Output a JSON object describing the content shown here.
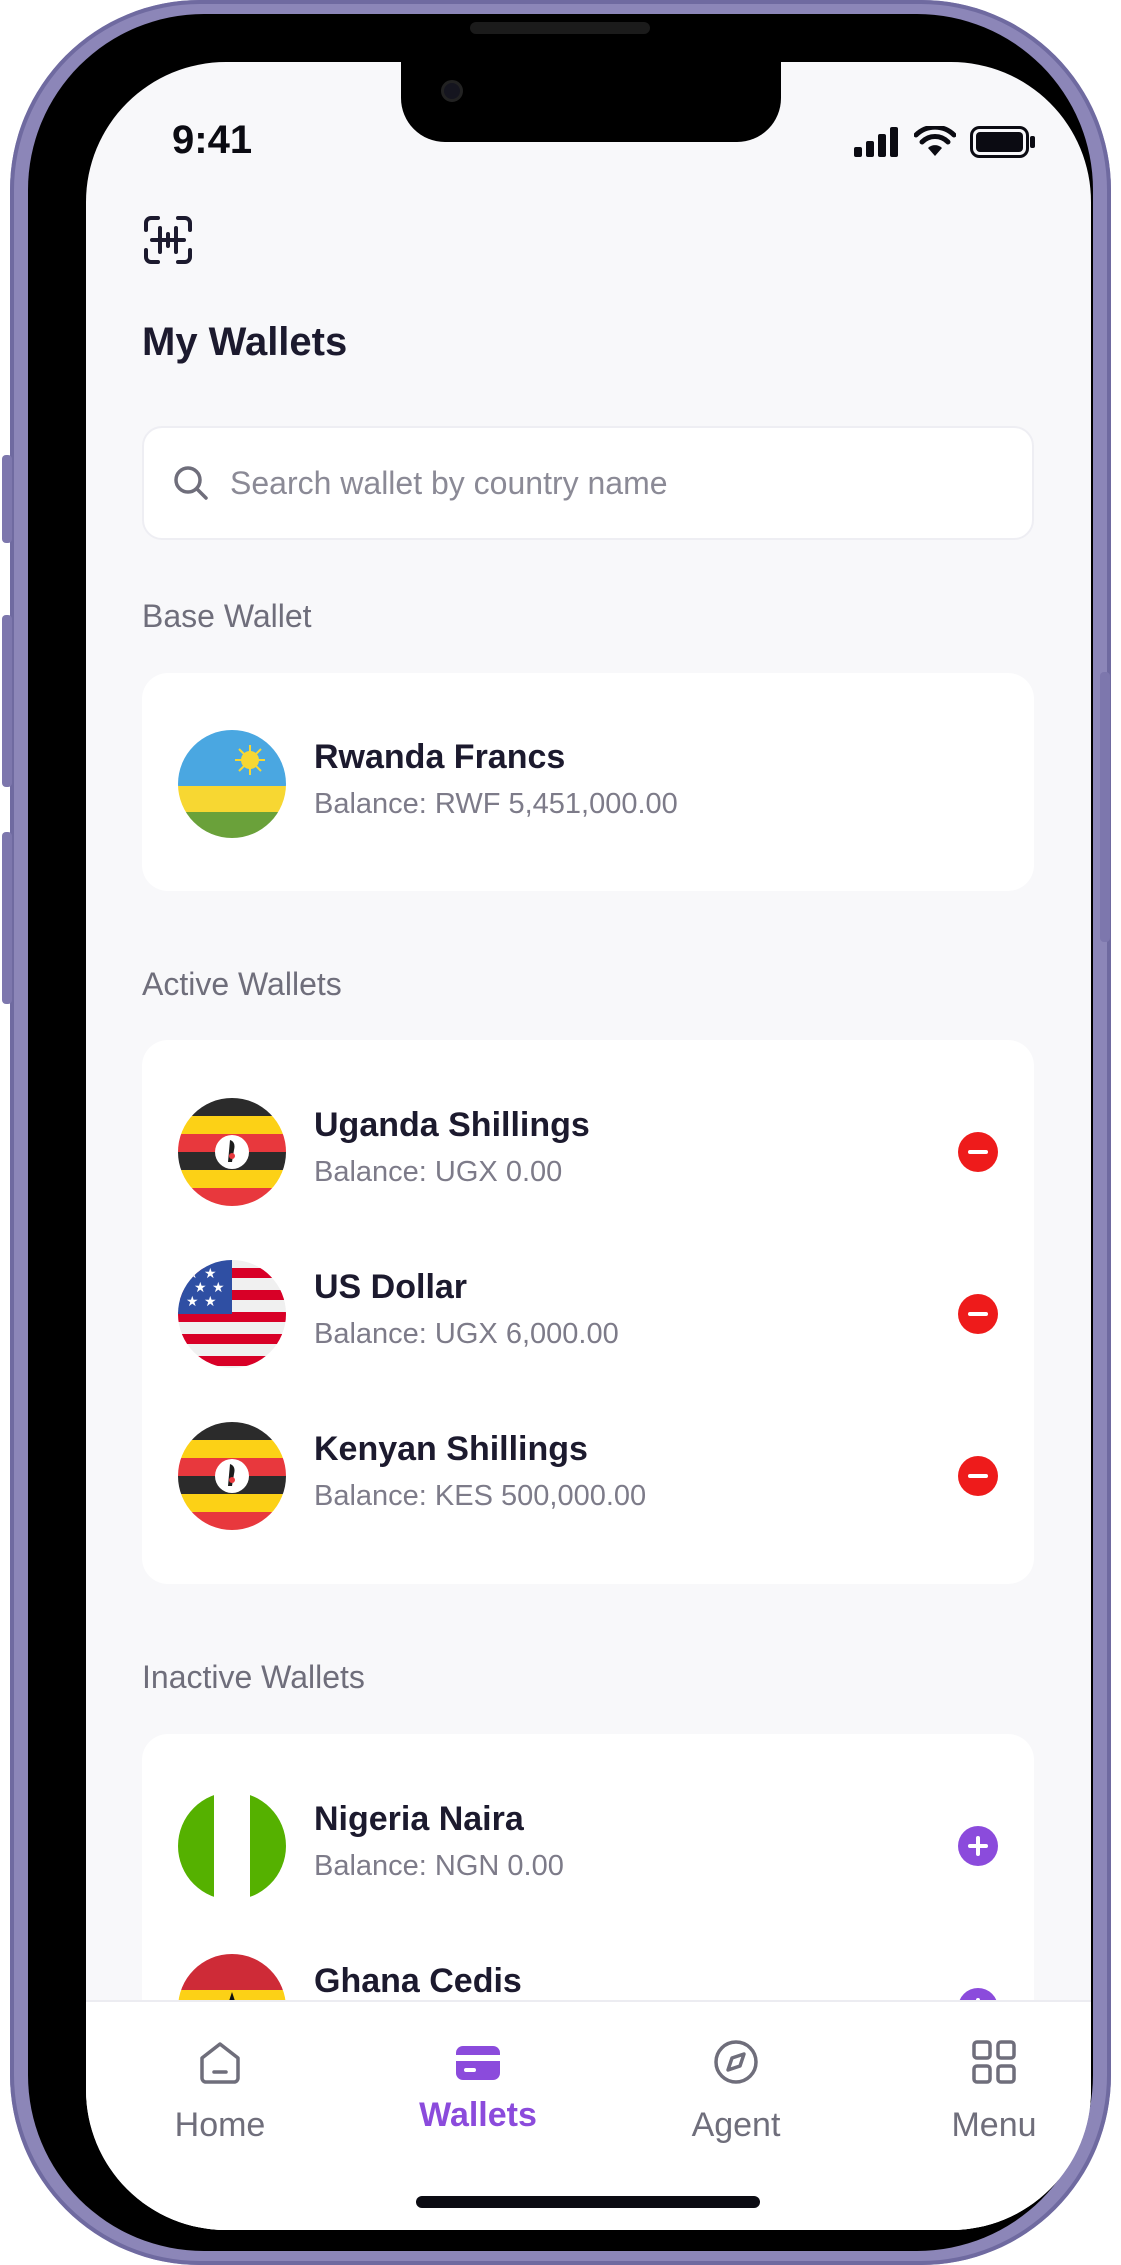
{
  "status_bar": {
    "time": "9:41"
  },
  "header": {
    "title": "My Wallets"
  },
  "search": {
    "placeholder": "Search wallet by country name",
    "value": ""
  },
  "sections": {
    "base": {
      "title": "Base Wallet",
      "wallets": [
        {
          "name": "Rwanda Francs",
          "balance": "Balance: RWF 5,451,000.00",
          "flag": "rwanda"
        }
      ]
    },
    "active": {
      "title": "Active Wallets",
      "wallets": [
        {
          "name": "Uganda Shillings",
          "balance": "Balance: UGX 0.00",
          "flag": "uganda",
          "action": "remove"
        },
        {
          "name": "US Dollar",
          "balance": "Balance: UGX 6,000.00",
          "flag": "usa",
          "action": "remove"
        },
        {
          "name": "Kenyan Shillings",
          "balance": "Balance: KES 500,000.00",
          "flag": "uganda",
          "action": "remove"
        }
      ]
    },
    "inactive": {
      "title": "Inactive Wallets",
      "wallets": [
        {
          "name": "Nigeria Naira",
          "balance": "Balance: NGN 0.00",
          "flag": "nigeria",
          "action": "add"
        },
        {
          "name": "Ghana Cedis",
          "balance": "",
          "flag": "ghana",
          "action": "add"
        }
      ]
    }
  },
  "nav": {
    "items": [
      {
        "label": "Home",
        "icon": "home-icon",
        "active": false
      },
      {
        "label": "Wallets",
        "icon": "wallet-icon",
        "active": true
      },
      {
        "label": "Agent",
        "icon": "compass-icon",
        "active": false
      },
      {
        "label": "Menu",
        "icon": "grid-icon",
        "active": false
      }
    ]
  },
  "colors": {
    "accent": "#8b4bdc",
    "remove": "#ee1b1b",
    "background": "#f8f8fa"
  }
}
